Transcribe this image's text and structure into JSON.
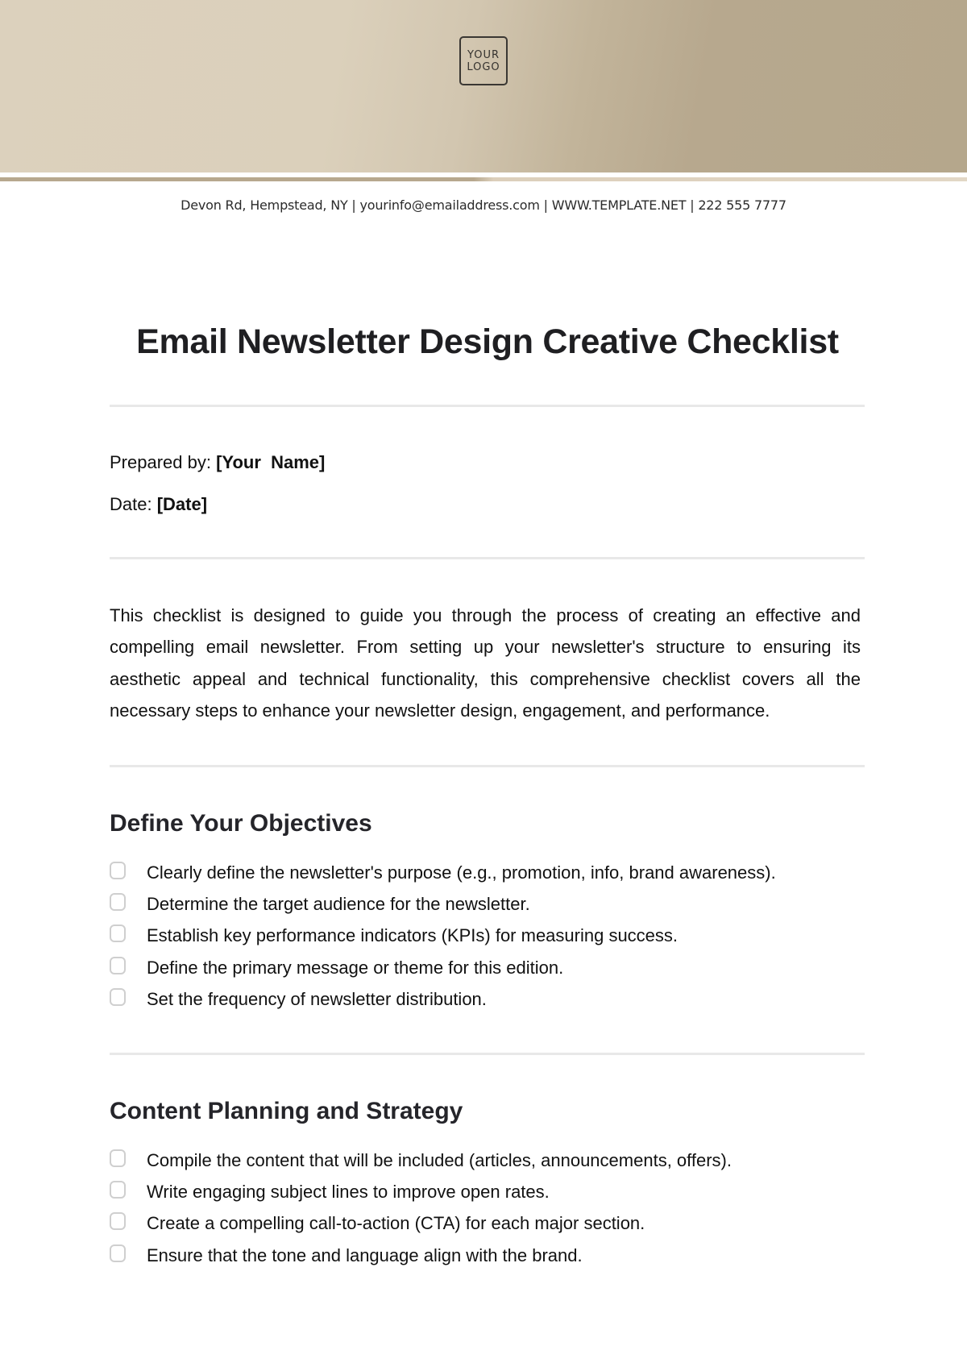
{
  "header": {
    "logo_line1": "YOUR",
    "logo_line2": "LOGO",
    "contact": "Devon Rd, Hempstead, NY | yourinfo@emailaddress.com | WWW.TEMPLATE.NET | 222 555 7777",
    "colors": {
      "band_light": "#dcd1bd",
      "band_dark": "#b5a78c"
    }
  },
  "document": {
    "title": "Email Newsletter Design Creative Checklist",
    "prepared_by_label": "Prepared by:",
    "prepared_by_value": "[Your  Name]",
    "date_label": "Date:",
    "date_value": "[Date]",
    "intro": "This checklist is designed to guide you through the process of creating an effective and compelling email newsletter. From setting up your newsletter's structure to ensuring its aesthetic appeal and technical functionality, this comprehensive checklist covers all the necessary steps to enhance your newsletter design, engagement, and performance."
  },
  "sections": [
    {
      "title": "Define Your Objectives",
      "items": [
        {
          "label": "Clearly define the newsletter's purpose (e.g., promotion, info, brand awareness).",
          "checked": false
        },
        {
          "label": "Determine the target audience for the newsletter.",
          "checked": false
        },
        {
          "label": "Establish key performance indicators (KPIs) for measuring success.",
          "checked": false
        },
        {
          "label": "Define the primary message or theme for this edition.",
          "checked": false
        },
        {
          "label": "Set the frequency of newsletter distribution.",
          "checked": false
        }
      ]
    },
    {
      "title": "Content Planning and Strategy",
      "items": [
        {
          "label": "Compile the content that will be included (articles, announcements, offers).",
          "checked": false
        },
        {
          "label": "Write engaging subject lines to improve open rates.",
          "checked": false
        },
        {
          "label": "Create a compelling call-to-action (CTA) for each major section.",
          "checked": false
        },
        {
          "label": "Ensure that the tone and language align with the brand.",
          "checked": false
        }
      ]
    }
  ]
}
